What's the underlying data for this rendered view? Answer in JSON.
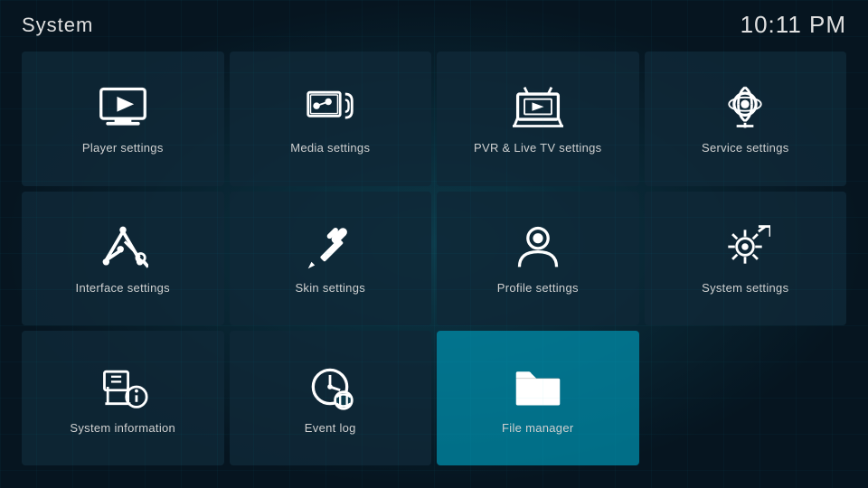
{
  "header": {
    "title": "System",
    "time": "10:11 PM"
  },
  "tiles": [
    {
      "id": "player-settings",
      "label": "Player settings",
      "icon": "player",
      "active": false
    },
    {
      "id": "media-settings",
      "label": "Media settings",
      "icon": "media",
      "active": false
    },
    {
      "id": "pvr-settings",
      "label": "PVR & Live TV settings",
      "icon": "pvr",
      "active": false
    },
    {
      "id": "service-settings",
      "label": "Service settings",
      "icon": "service",
      "active": false
    },
    {
      "id": "interface-settings",
      "label": "Interface settings",
      "icon": "interface",
      "active": false
    },
    {
      "id": "skin-settings",
      "label": "Skin settings",
      "icon": "skin",
      "active": false
    },
    {
      "id": "profile-settings",
      "label": "Profile settings",
      "icon": "profile",
      "active": false
    },
    {
      "id": "system-settings",
      "label": "System settings",
      "icon": "system",
      "active": false
    },
    {
      "id": "system-information",
      "label": "System information",
      "icon": "info",
      "active": false
    },
    {
      "id": "event-log",
      "label": "Event log",
      "icon": "eventlog",
      "active": false
    },
    {
      "id": "file-manager",
      "label": "File manager",
      "icon": "filemanager",
      "active": true
    }
  ]
}
